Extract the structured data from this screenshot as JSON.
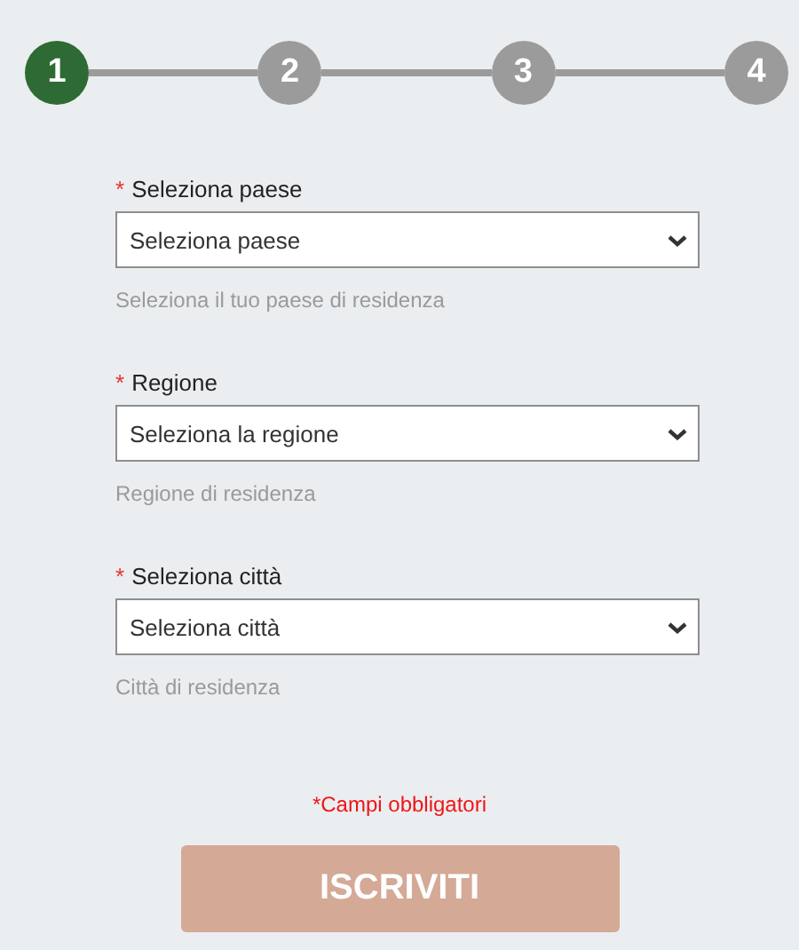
{
  "steps": [
    {
      "label": "1",
      "selected": true
    },
    {
      "label": "2",
      "selected": false
    },
    {
      "label": "3",
      "selected": false
    },
    {
      "label": "4",
      "selected": false
    }
  ],
  "fields": [
    {
      "required_mark": "*",
      "label": "Seleziona paese",
      "placeholder": "Seleziona paese",
      "hint": "Seleziona il tuo paese di residenza"
    },
    {
      "required_mark": "*",
      "label": "Regione",
      "placeholder": "Seleziona la regione",
      "hint": "Regione di residenza"
    },
    {
      "required_mark": "*",
      "label": "Seleziona città",
      "placeholder": "Seleziona città",
      "hint": "Città di residenza"
    }
  ],
  "required_note": "*Campi obbligatori",
  "submit": {
    "label": "ISCRIVITI",
    "disabled": true
  }
}
